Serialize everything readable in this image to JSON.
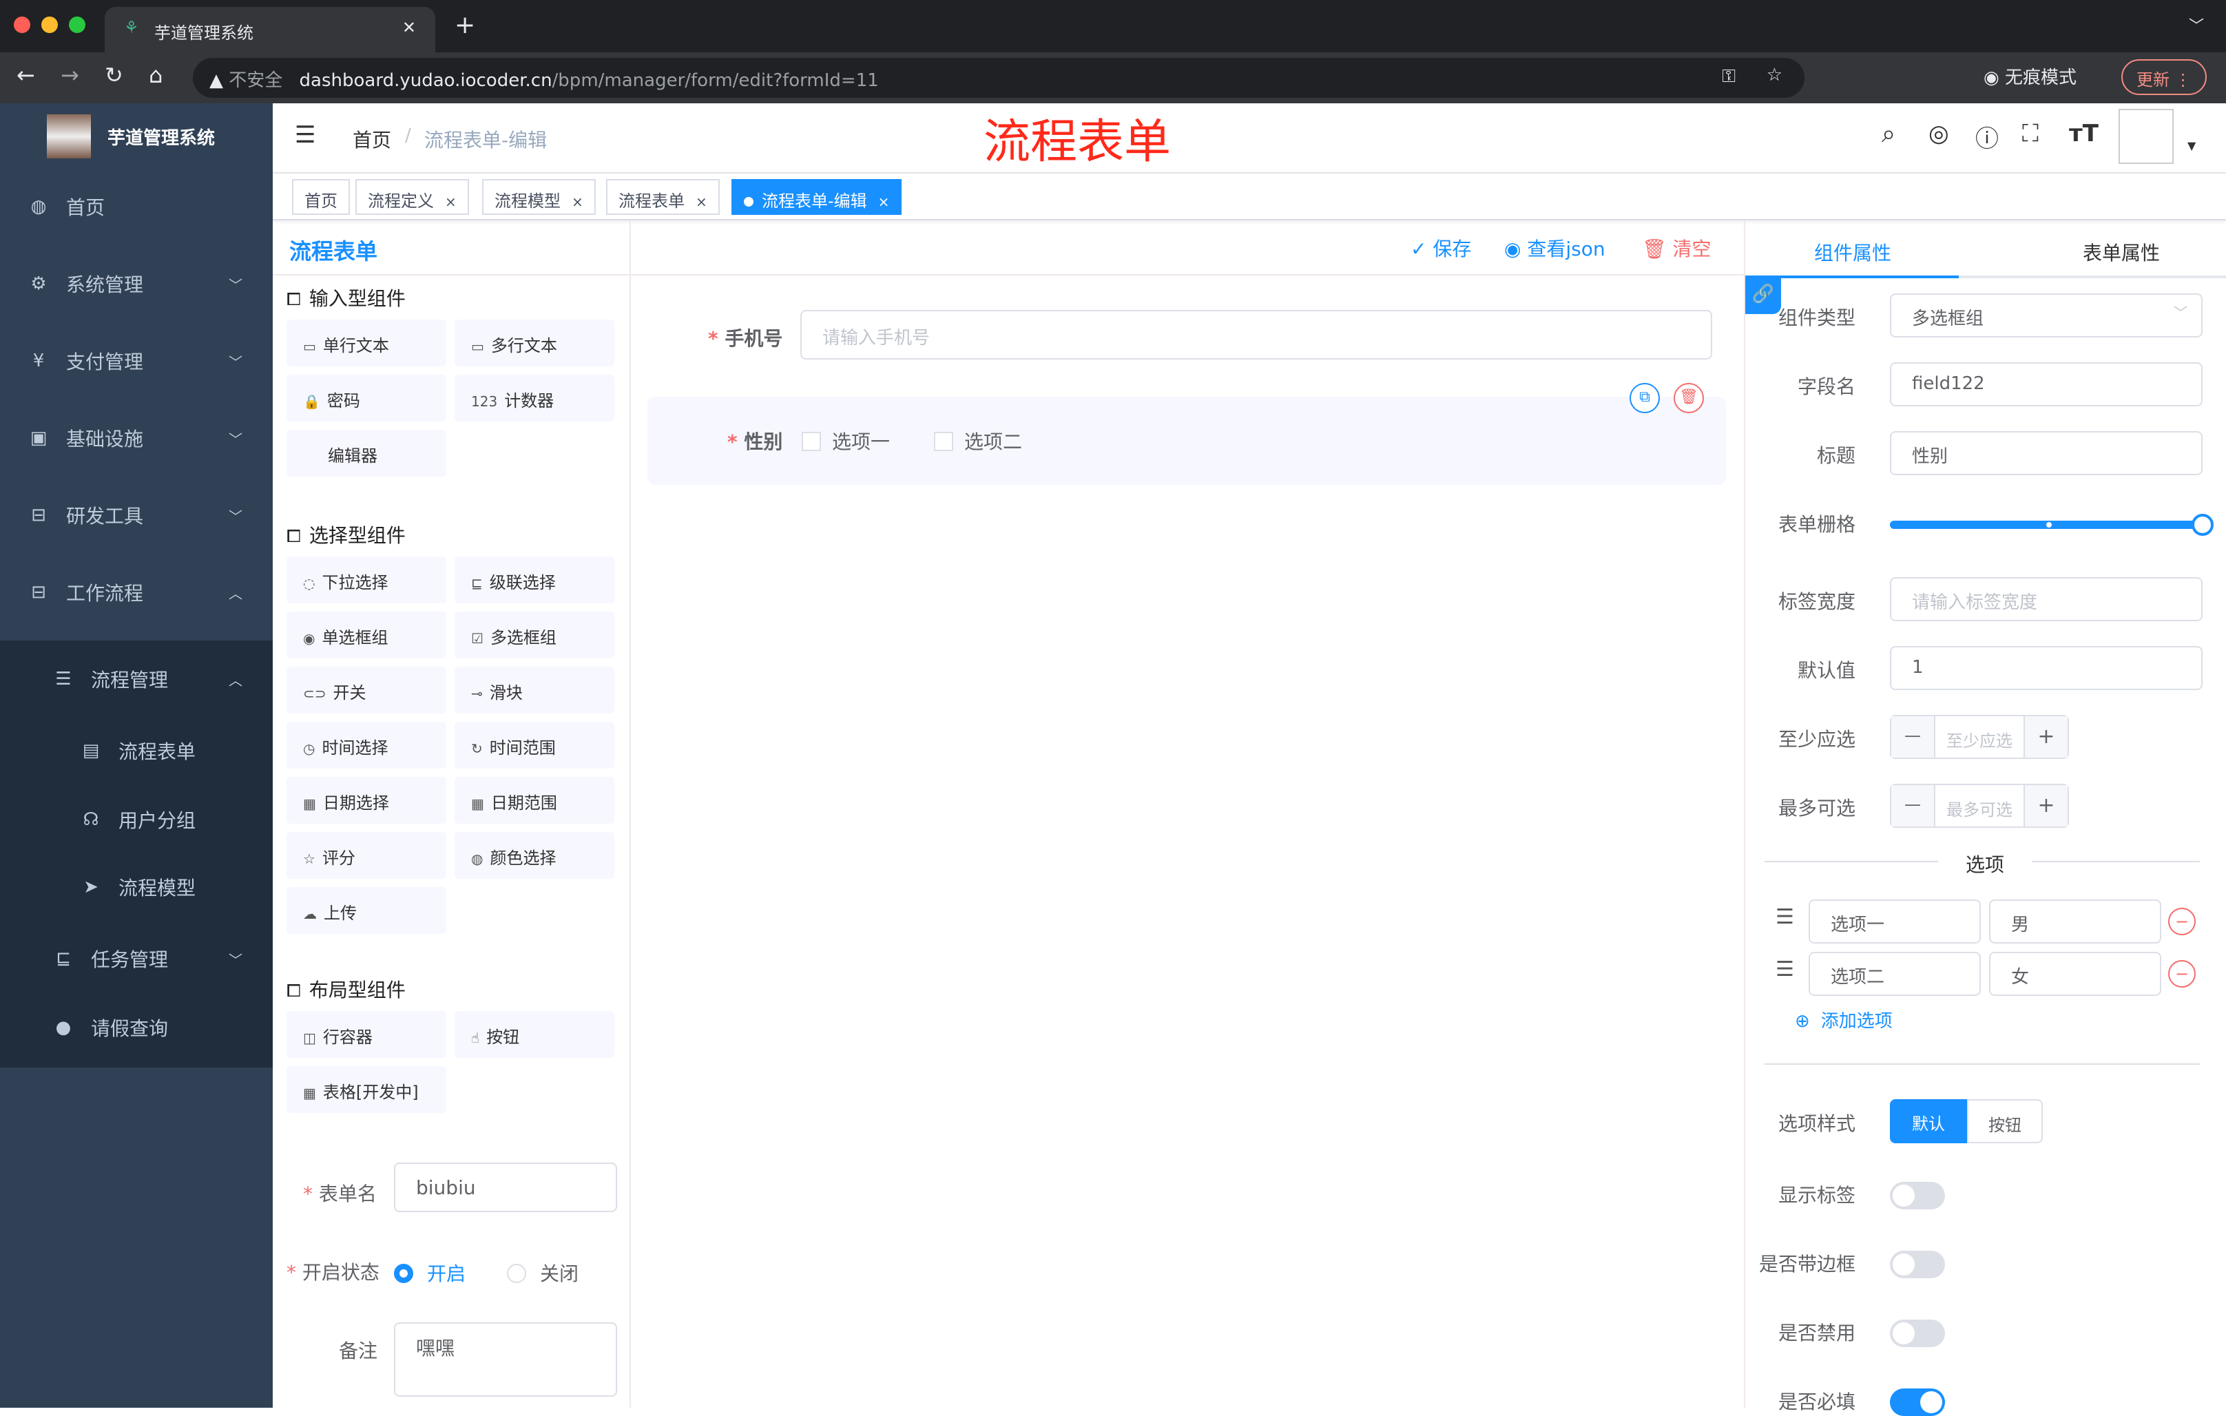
{
  "browser": {
    "tab_title": "芋道管理系统",
    "insecure": "不安全",
    "url_host": "dashboard.yudao.iocoder.cn",
    "url_path": "/bpm/manager/form/edit?formId=11",
    "incognito": "无痕模式",
    "update": "更新"
  },
  "sidebar": {
    "app_title": "芋道管理系统",
    "items": [
      {
        "label": "首页",
        "icon": "dashboard-icon",
        "glyph": "◍"
      },
      {
        "label": "系统管理",
        "icon": "gear-icon",
        "glyph": "⚙",
        "chevron": "﹀"
      },
      {
        "label": "支付管理",
        "icon": "yen-icon",
        "glyph": "¥",
        "chevron": "﹀"
      },
      {
        "label": "基础设施",
        "icon": "monitor-icon",
        "glyph": "▣",
        "chevron": "﹀"
      },
      {
        "label": "研发工具",
        "icon": "toolbox-icon",
        "glyph": "⊟",
        "chevron": "﹀"
      },
      {
        "label": "工作流程",
        "icon": "workflow-icon",
        "glyph": "⊟",
        "chevron": "︿"
      }
    ],
    "sub": [
      {
        "label": "流程管理",
        "icon": "tree-icon",
        "glyph": "☰",
        "chevron": "︿",
        "indent": 1
      },
      {
        "label": "流程表单",
        "icon": "form-icon",
        "glyph": "▤",
        "indent": 2
      },
      {
        "label": "用户分组",
        "icon": "group-icon",
        "glyph": "☊",
        "indent": 2
      },
      {
        "label": "流程模型",
        "icon": "send-icon",
        "glyph": "➤",
        "indent": 2
      },
      {
        "label": "任务管理",
        "icon": "task-icon",
        "glyph": "⊑",
        "chevron": "﹀",
        "indent": 1
      },
      {
        "label": "请假查询",
        "icon": "user-icon",
        "glyph": "●",
        "indent": 1
      }
    ]
  },
  "navbar": {
    "breadcrumb_home": "首页",
    "breadcrumb_sep": "/",
    "breadcrumb_current": "流程表单-编辑",
    "overlay_title": "流程表单"
  },
  "tags": [
    {
      "label": "首页"
    },
    {
      "label": "流程定义",
      "close": "×"
    },
    {
      "label": "流程模型",
      "close": "×"
    },
    {
      "label": "流程表单",
      "close": "×"
    },
    {
      "label": "流程表单-编辑",
      "close": "×",
      "active": true
    }
  ],
  "left": {
    "title": "流程表单",
    "sections": [
      {
        "title": "输入型组件",
        "items": [
          {
            "label": "单行文本",
            "glyph": "▭"
          },
          {
            "label": "多行文本",
            "glyph": "▭"
          },
          {
            "label": "密码",
            "glyph": "🔒"
          },
          {
            "label": "计数器",
            "glyph": "123"
          },
          {
            "label": "编辑器",
            "glyph": ""
          }
        ]
      },
      {
        "title": "选择型组件",
        "items": [
          {
            "label": "下拉选择",
            "glyph": "◌"
          },
          {
            "label": "级联选择",
            "glyph": "⊑"
          },
          {
            "label": "单选框组",
            "glyph": "◉"
          },
          {
            "label": "多选框组",
            "glyph": "☑"
          },
          {
            "label": "开关",
            "glyph": "⊂⊃"
          },
          {
            "label": "滑块",
            "glyph": "⊸"
          },
          {
            "label": "时间选择",
            "glyph": "◷"
          },
          {
            "label": "时间范围",
            "glyph": "↻"
          },
          {
            "label": "日期选择",
            "glyph": "▦"
          },
          {
            "label": "日期范围",
            "glyph": "▦"
          },
          {
            "label": "评分",
            "glyph": "☆"
          },
          {
            "label": "颜色选择",
            "glyph": "◍"
          },
          {
            "label": "上传",
            "glyph": "☁"
          }
        ]
      },
      {
        "title": "布局型组件",
        "items": [
          {
            "label": "行容器",
            "glyph": "◫"
          },
          {
            "label": "按钮",
            "glyph": "☝"
          },
          {
            "label": "表格[开发中]",
            "glyph": "▦"
          }
        ]
      }
    ],
    "form_name_label": "表单名",
    "form_name_value": "biubiu",
    "status_label": "开启状态",
    "status_on": "开启",
    "status_off": "关闭",
    "remark_label": "备注",
    "remark_value": "嘿嘿"
  },
  "toolbar": {
    "save": "保存",
    "view_json": "查看json",
    "clear": "清空"
  },
  "canvas": {
    "phone_label": "手机号",
    "phone_placeholder": "请输入手机号",
    "gender_label": "性别",
    "option1": "选项一",
    "option2": "选项二"
  },
  "right": {
    "tab_component": "组件属性",
    "tab_form": "表单属性",
    "type_label": "组件类型",
    "type_value": "多选框组",
    "field_label": "字段名",
    "field_value": "field122",
    "title_label": "标题",
    "title_value": "性别",
    "grid_label": "表单栅格",
    "grid_value": 24,
    "grid_max": 24,
    "label_width_label": "标签宽度",
    "label_width_placeholder": "请输入标签宽度",
    "default_label": "默认值",
    "default_value": "1",
    "min_label": "至少应选",
    "min_placeholder": "至少应选",
    "max_label": "最多可选",
    "max_placeholder": "最多可选",
    "minus": "—",
    "plus": "+",
    "options_title": "选项",
    "options": [
      {
        "label": "选项一",
        "value": "男"
      },
      {
        "label": "选项二",
        "value": "女"
      }
    ],
    "add_option": "添加选项",
    "style_label": "选项样式",
    "style_default": "默认",
    "style_button": "按钮",
    "show_label": "显示标签",
    "show_label_on": true,
    "border_label": "是否带边框",
    "border_on": false,
    "disabled_label": "是否禁用",
    "disabled_on": false,
    "required_label": "是否必填",
    "required_on": true
  },
  "colors": {
    "accent": "#1890ff",
    "sidebar": "#304156",
    "submenu": "#1f2d3d",
    "danger": "#f56c6c",
    "title_red": "#ff2a1a"
  }
}
